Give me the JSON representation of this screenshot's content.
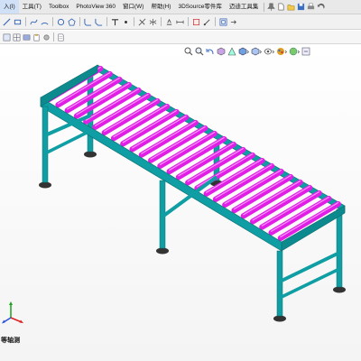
{
  "menubar": {
    "items": [
      "入(I)",
      "工具(T)",
      "Toolbox",
      "PhotoView 360",
      "窗口(W)",
      "帮助(H)",
      "3DSource零件库",
      "迈迪工具集"
    ]
  },
  "viewport": {
    "view_name": "等轴测"
  },
  "colors": {
    "frame": "#0f9ea3",
    "roller": "#e01ee6",
    "foot": "#333333"
  }
}
